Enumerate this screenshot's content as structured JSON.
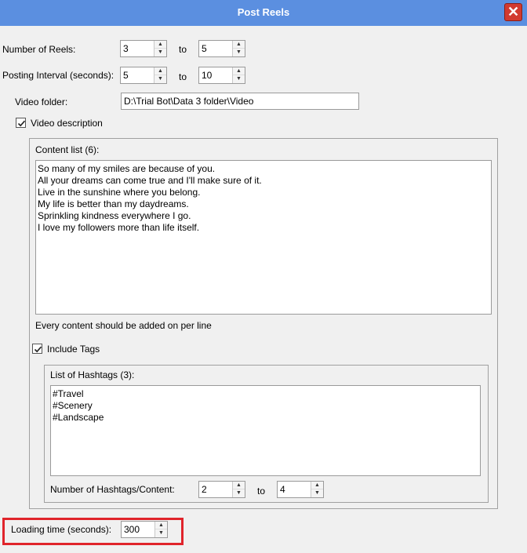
{
  "window": {
    "title": "Post Reels",
    "close_icon": "close-icon",
    "accent_color": "#5b8fe0",
    "close_color": "#d23a2f",
    "highlight_color": "#e0242b"
  },
  "reels": {
    "label": "Number of Reels:",
    "from": "3",
    "to_label": "to",
    "to": "5"
  },
  "interval": {
    "label": "Posting Interval (seconds):",
    "from": "5",
    "to_label": "to",
    "to": "10"
  },
  "video_folder": {
    "label": "Video folder:",
    "value": "D:\\Trial Bot\\Data 3 folder\\Video"
  },
  "video_description": {
    "label": "Video description",
    "checked": true,
    "content_list": {
      "label": "Content list (6):",
      "lines": [
        "So many of my smiles are because of you.",
        "All your dreams can come true and I'll make sure of it.",
        "Live in the sunshine where you belong.",
        "My life is better than my daydreams.",
        "Sprinkling kindness everywhere I go.",
        "I love my followers more than life itself."
      ],
      "hint": "Every content should be added on per line"
    }
  },
  "tags": {
    "label": "Include Tags",
    "checked": true,
    "hashtags": {
      "label": "List of Hashtags (3):",
      "lines": [
        "#Travel",
        "#Scenery",
        "#Landscape"
      ]
    },
    "per_content": {
      "label": "Number of Hashtags/Content:",
      "from": "2",
      "to_label": "to",
      "to": "4"
    }
  },
  "loading": {
    "label": "Loading time (seconds):",
    "value": "300"
  }
}
